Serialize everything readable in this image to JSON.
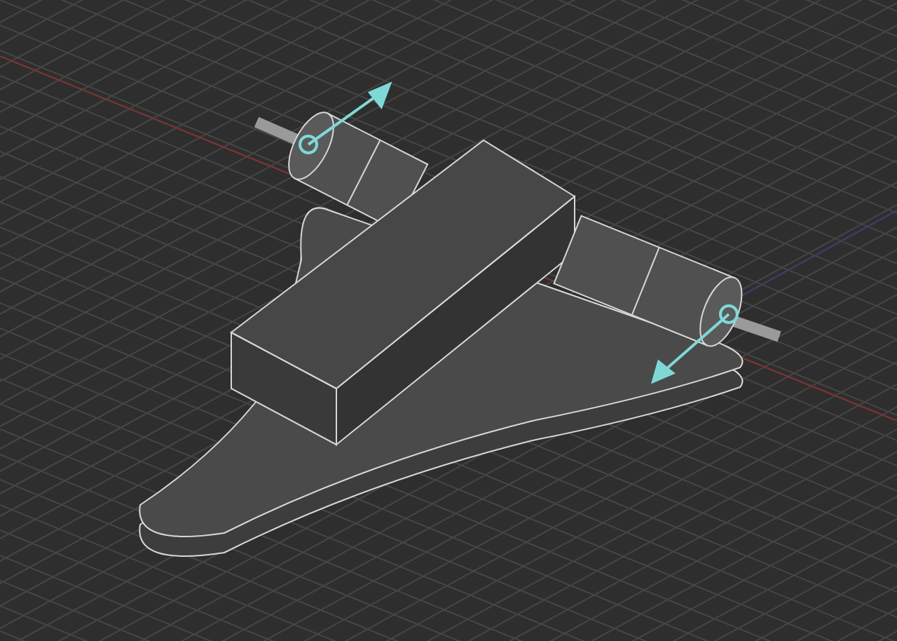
{
  "viewport": {
    "kind": "model-3d"
  }
}
